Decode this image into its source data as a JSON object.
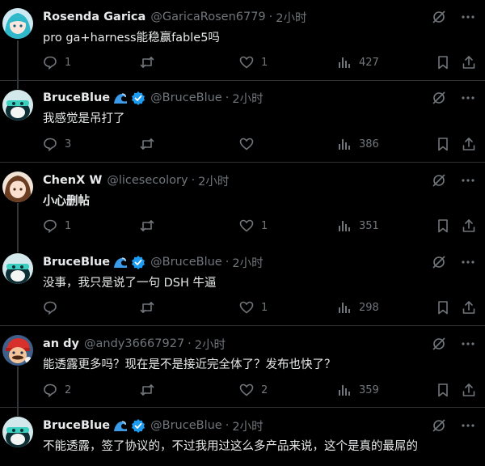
{
  "tweets": [
    {
      "name": "Rosenda Garica",
      "handle": "@GaricaRosen6779",
      "time": "2小时",
      "text": "pro ga+harness能稳赢fable5吗",
      "replies": "1",
      "retweets": "",
      "likes": "1",
      "views": "427",
      "verified": false
    },
    {
      "name": "BruceBlue",
      "handle": "@BruceBlue",
      "time": "2小时",
      "text": "我感觉是吊打了",
      "replies": "3",
      "retweets": "",
      "likes": "",
      "views": "386",
      "verified": true
    },
    {
      "name": "ChenX W",
      "handle": "@licesecolory",
      "time": "2小时",
      "text": "小心删帖",
      "replies": "1",
      "retweets": "",
      "likes": "1",
      "views": "351",
      "verified": false
    },
    {
      "name": "BruceBlue",
      "handle": "@BruceBlue",
      "time": "2小时",
      "text": "没事，我只是说了一句 DSH 牛逼",
      "replies": "",
      "retweets": "",
      "likes": "1",
      "views": "298",
      "verified": true
    },
    {
      "name": "an dy",
      "handle": "@andy36667927",
      "time": "2小时",
      "text": "能透露更多吗？现在是不是接近完全体了？发布也快了？",
      "replies": "2",
      "retweets": "",
      "likes": "2",
      "views": "359",
      "verified": false
    },
    {
      "name": "BruceBlue",
      "handle": "@BruceBlue",
      "time": "2小时",
      "text": "不能透露，签了协议的，不过我用过这么多产品来说，这个是真的最屌的",
      "verified": true
    }
  ],
  "colors": {
    "background": "#000000",
    "text": "#e7e9ea",
    "muted": "#71767b",
    "verified": "#1d9bf0",
    "divider": "#2f3336"
  }
}
